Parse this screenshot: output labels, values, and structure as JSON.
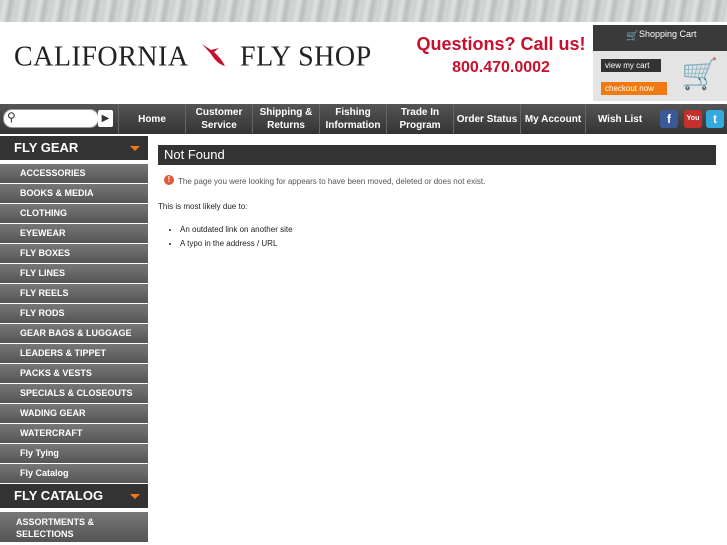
{
  "header": {
    "logo_left": "CALIFORNIA",
    "logo_right": "FLY SHOP",
    "questions": "Questions? Call us!",
    "phone": "800.470.0002"
  },
  "cart": {
    "title": "Shopping Cart",
    "view": "view my cart",
    "checkout": "checkout now"
  },
  "nav": {
    "home": "Home",
    "customer": "Customer Service",
    "shipping": "Shipping & Returns",
    "fishing": "Fishing Information",
    "tradein": "Trade In Program",
    "order": "Order Status",
    "account": "My Account",
    "wish": "Wish List"
  },
  "social": {
    "facebook": "f",
    "youtube": "You",
    "twitter": "t"
  },
  "sidebar": {
    "flygear": "FLY GEAR",
    "items": [
      "ACCESSORIES",
      "BOOKS & MEDIA",
      "CLOTHING",
      "EYEWEAR",
      "FLY BOXES",
      "FLY LINES",
      "FLY REELS",
      "FLY RODS",
      "GEAR BAGS & LUGGAGE",
      "LEADERS & TIPPET",
      "PACKS & VESTS",
      "SPECIALS & CLOSEOUTS",
      "WADING GEAR",
      "WATERCRAFT",
      "Fly Tying",
      "Fly Catalog"
    ],
    "flycatalog": "FLY CATALOG",
    "assort1": "ASSORTMENTS &",
    "assort2": "SELECTIONS"
  },
  "main": {
    "title": "Not Found",
    "notice": "The page you were looking for appears to have been moved, deleted or does not exist.",
    "reason": "This is most likely due to:",
    "bullets": [
      "An outdated link on another site",
      "A typo in the address / URL"
    ]
  }
}
